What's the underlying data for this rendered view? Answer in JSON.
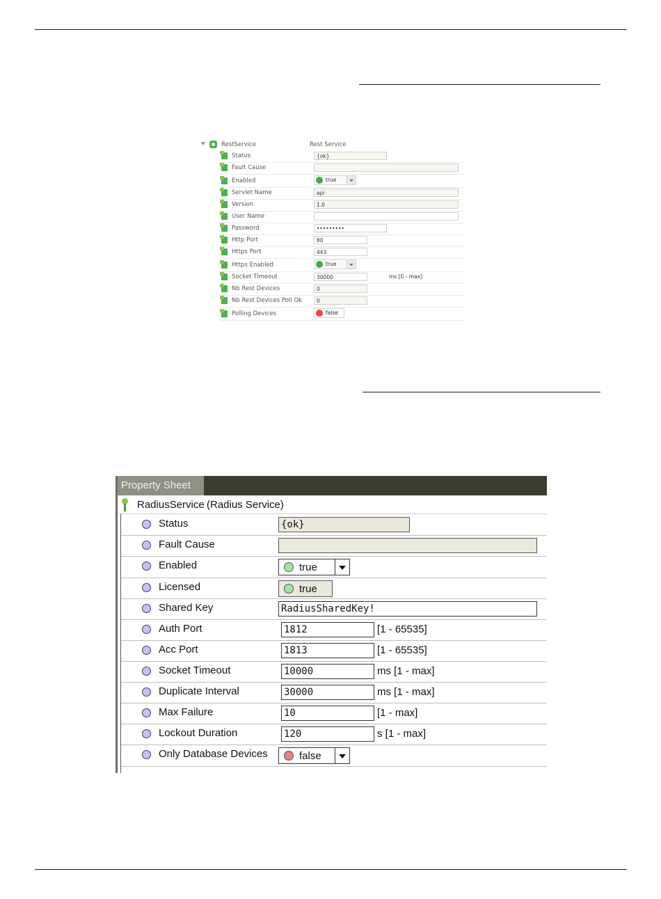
{
  "colors": {
    "status_true": "#a6e3a1",
    "status_false": "#e88383",
    "rest_true": "#3fae49",
    "rest_false": "#e5474d",
    "tab_bg": "#909084",
    "tabbar_bg": "#3c3c30",
    "readonly_field": "#ebe8dc"
  },
  "rest": {
    "root": {
      "name": "RestService",
      "display": "Rest Service",
      "icon": "gear-icon"
    },
    "rows": [
      {
        "label": "Status",
        "value": "{ok}"
      },
      {
        "label": "Fault Cause",
        "value": ""
      },
      {
        "label": "Enabled",
        "value": "true"
      },
      {
        "label": "Servlet Name",
        "value": "api"
      },
      {
        "label": "Version",
        "value": "1.0"
      },
      {
        "label": "User Name",
        "value": ""
      },
      {
        "label": "Password",
        "value": "•••••••••"
      },
      {
        "label": "Http Port",
        "value": "80"
      },
      {
        "label": "Https Port",
        "value": "443"
      },
      {
        "label": "Https Enabled",
        "value": "true"
      },
      {
        "label": "Socket Timeout",
        "value": "30000",
        "unit": "ms [0 - max]"
      },
      {
        "label": "Nb Rest Devices",
        "value": "0"
      },
      {
        "label": "Nb Rest Devices Poll Ok",
        "value": "0"
      },
      {
        "label": "Polling Devices",
        "value": "false"
      }
    ]
  },
  "property_sheet": {
    "tab_label": "Property Sheet",
    "root": {
      "name": "RadiusService",
      "display": "(Radius Service)",
      "icon": "key-icon"
    },
    "rows": [
      {
        "label": "Status",
        "value": "{ok}"
      },
      {
        "label": "Fault Cause",
        "value": ""
      },
      {
        "label": "Enabled",
        "value": "true"
      },
      {
        "label": "Licensed",
        "value": "true"
      },
      {
        "label": "Shared Key",
        "value": "RadiusSharedKey!"
      },
      {
        "label": "Auth Port",
        "value": "1812",
        "unit": "[1 - 65535]"
      },
      {
        "label": "Acc Port",
        "value": "1813",
        "unit": "[1 - 65535]"
      },
      {
        "label": "Socket Timeout",
        "value": "10000",
        "unit": "ms [1 - max]"
      },
      {
        "label": "Duplicate Interval",
        "value": "30000",
        "unit": "ms [1 - max]"
      },
      {
        "label": "Max Failure",
        "value": "10",
        "unit": "[1 - max]"
      },
      {
        "label": "Lockout Duration",
        "value": "120",
        "unit": "s [1 - max]"
      },
      {
        "label": "Only Database Devices",
        "value": "false"
      }
    ]
  }
}
